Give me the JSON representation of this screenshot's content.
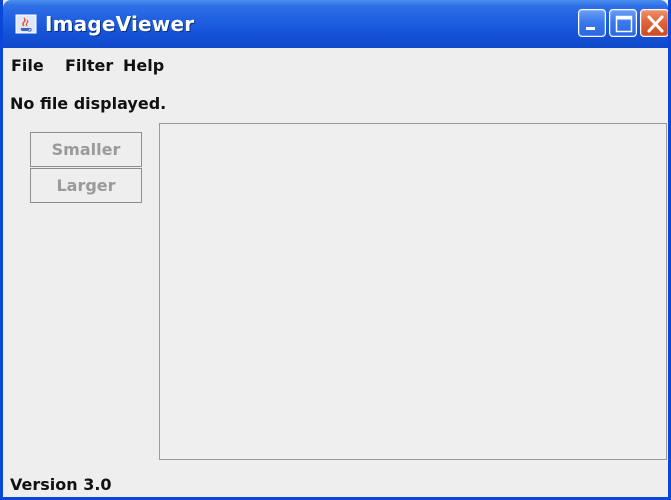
{
  "window": {
    "title": "ImageViewer",
    "app_icon": "java-coffee-cup-icon",
    "controls": [
      "minimize-icon",
      "maximize-icon",
      "close-icon"
    ]
  },
  "menu": {
    "items": [
      {
        "label": "File"
      },
      {
        "label": "Filter"
      },
      {
        "label": "Help"
      }
    ]
  },
  "status": {
    "filename": "No file displayed."
  },
  "toolbar": {
    "smaller_label": "Smaller",
    "larger_label": "Larger"
  },
  "footer": {
    "version": "Version 3.0"
  },
  "colors": {
    "titlebar": "#1e5ee0",
    "window_border": "#0a46d8",
    "background": "#eeeeee",
    "disabled_text": "#9a9a9a",
    "close_button": "#e0643d"
  }
}
